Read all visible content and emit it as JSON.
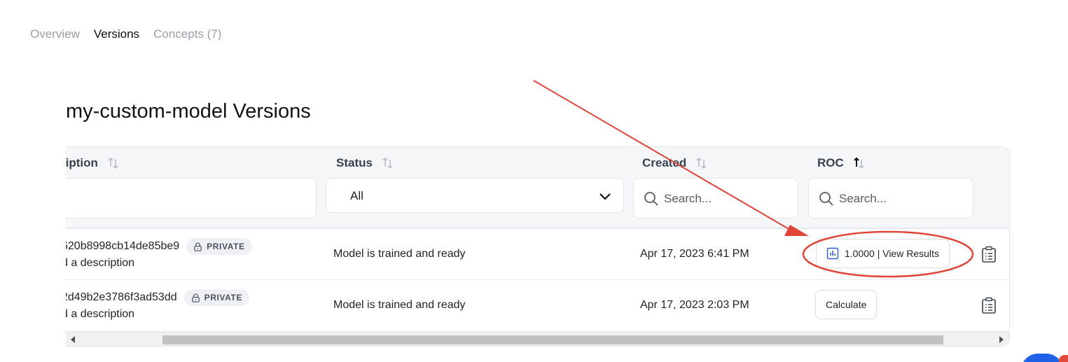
{
  "tabs": [
    {
      "label": "Overview",
      "active": false
    },
    {
      "label": "Versions",
      "active": true
    },
    {
      "label": "Concepts (7)",
      "active": false
    }
  ],
  "heading": "my-custom-model Versions",
  "table": {
    "columns": {
      "description": "ription",
      "status": "Status",
      "created": "Created",
      "roc": "ROC"
    },
    "filters": {
      "status_selected": "All",
      "created_placeholder": "Search...",
      "roc_placeholder": "Search..."
    },
    "rows": [
      {
        "id": "620b8998cb14de85be9",
        "visibility": "PRIVATE",
        "description": "d a description",
        "status": "Model is trained and ready",
        "created": "Apr 17, 2023 6:41 PM",
        "roc_action": "1.0000 | View Results"
      },
      {
        "id": "2d49b2e3786f3ad53dd",
        "visibility": "PRIVATE",
        "description": "d a description",
        "status": "Model is trained and ready",
        "created": "Apr 17, 2023 2:03 PM",
        "roc_action": "Calculate"
      }
    ]
  },
  "colors": {
    "annotation": "#e0453a",
    "accent": "#1f62e8"
  },
  "icons": [
    "sort-icon",
    "sort-asc-icon",
    "chevron-down-icon",
    "search-icon",
    "lock-icon",
    "bar-chart-icon",
    "clipboard-icon"
  ]
}
